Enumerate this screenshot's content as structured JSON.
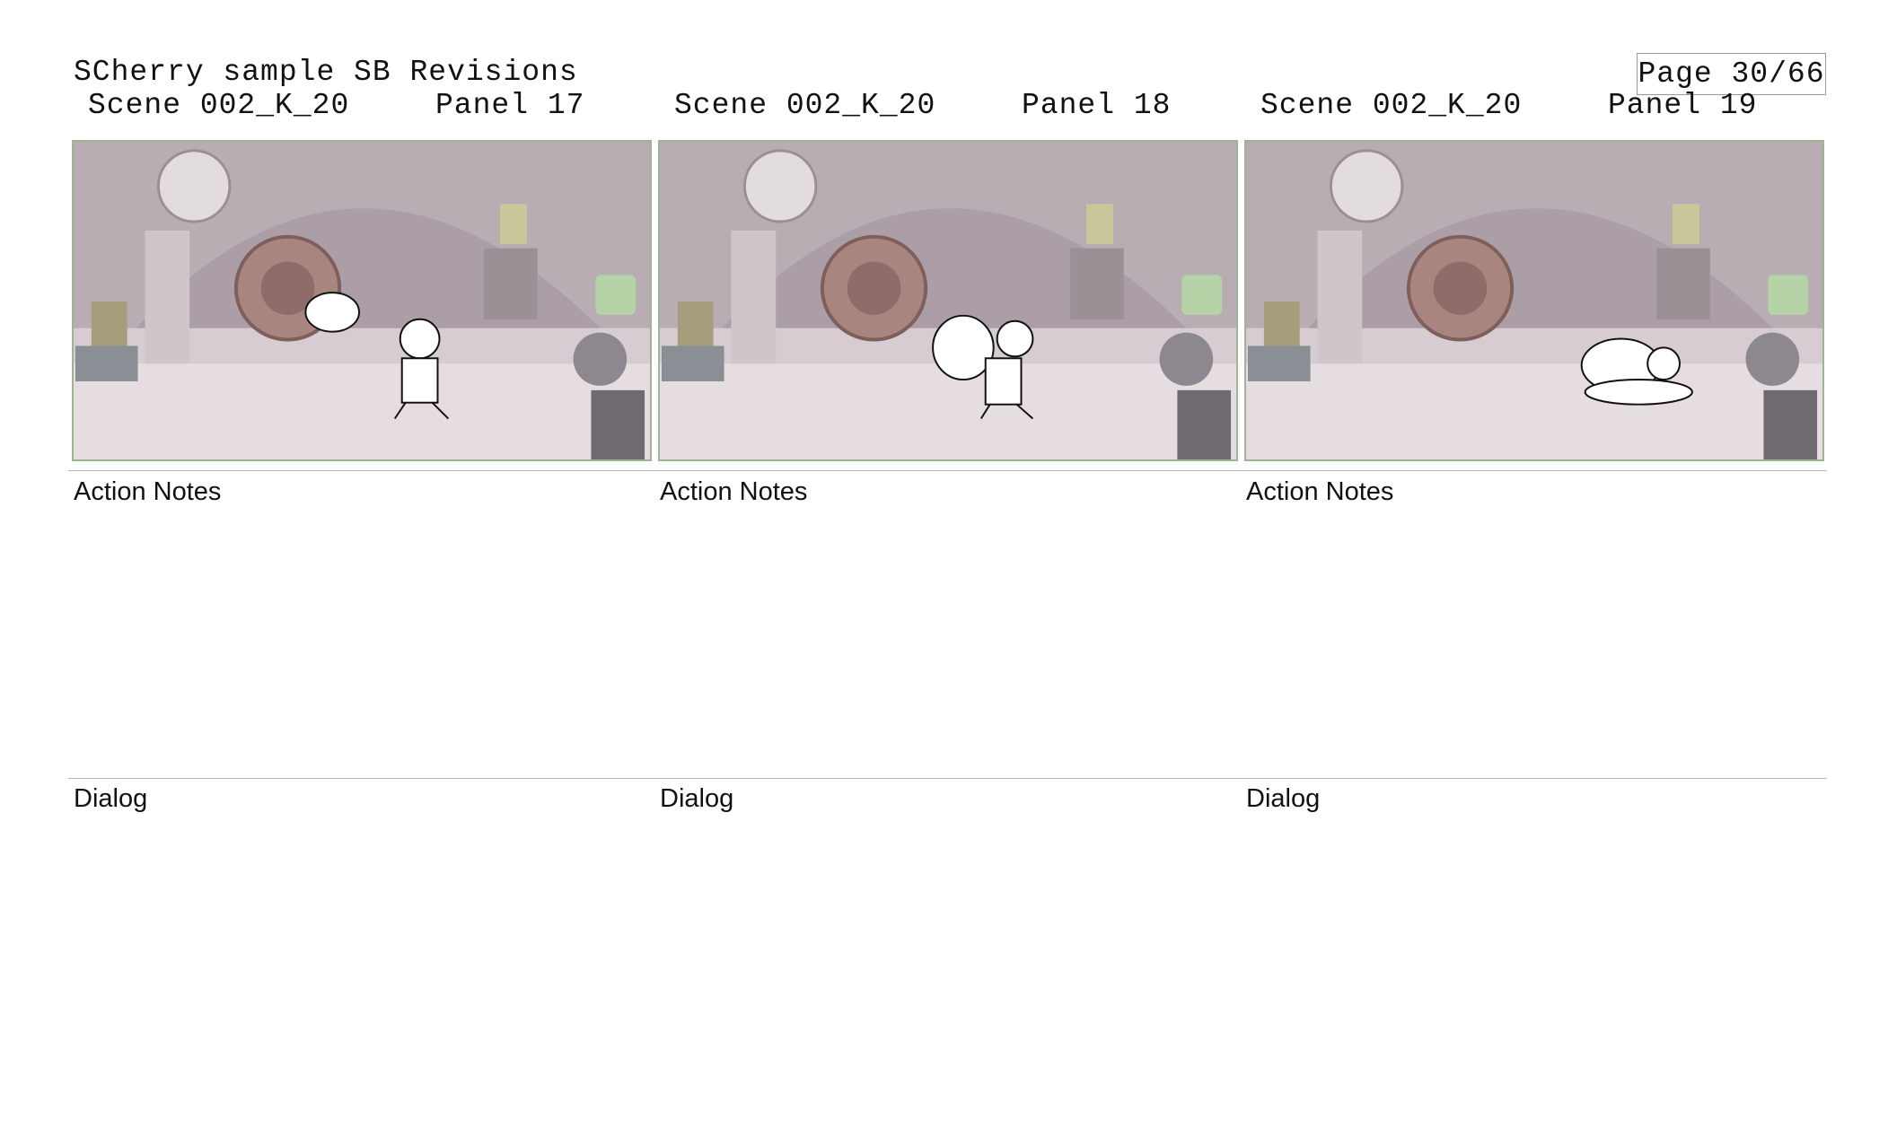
{
  "document": {
    "title": "SCherry sample SB Revisions",
    "page_label": "Page 30/66"
  },
  "panels": [
    {
      "scene": "Scene 002_K_20",
      "panel": "Panel 17",
      "action_label": "Action Notes",
      "dialog_label": "Dialog"
    },
    {
      "scene": "Scene 002_K_20",
      "panel": "Panel 18",
      "action_label": "Action Notes",
      "dialog_label": "Dialog"
    },
    {
      "scene": "Scene 002_K_20",
      "panel": "Panel 19",
      "action_label": "Action Notes",
      "dialog_label": "Dialog"
    }
  ],
  "colors": {
    "frame_border": "#9fb497",
    "rule": "#b5b5b5",
    "background_wash": "#d8cfd3"
  }
}
